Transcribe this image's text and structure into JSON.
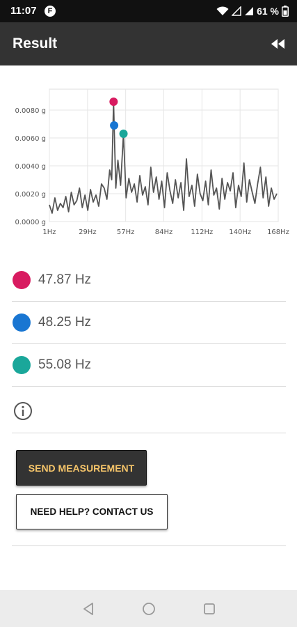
{
  "status_bar": {
    "time": "11:07",
    "app_icon_letter": "F",
    "battery_text": "61 %"
  },
  "app_bar": {
    "title": "Result"
  },
  "chart_data": {
    "type": "line",
    "x_tick_labels": [
      "1Hz",
      "29Hz",
      "57Hz",
      "84Hz",
      "112Hz",
      "140Hz",
      "168Hz"
    ],
    "y_tick_labels": [
      "0.0000 g",
      "0.0020 g",
      "0.0040 g",
      "0.0060 g",
      "0.0080 g"
    ],
    "xlim": [
      1,
      168
    ],
    "ylim": [
      0,
      0.0095
    ],
    "grid": true,
    "series_color": "#555555",
    "series": [
      {
        "x": [
          1,
          3,
          5,
          7,
          9,
          11,
          13,
          15,
          17,
          19,
          21,
          23,
          25,
          27,
          29,
          31,
          33,
          35,
          37,
          39,
          41,
          43,
          45,
          46.5,
          47.87,
          48.25,
          49.5,
          51,
          53,
          55.08,
          57,
          59,
          61,
          63,
          65,
          67,
          69,
          71,
          73,
          75,
          77,
          79,
          81,
          83,
          85,
          87,
          89,
          91,
          93,
          95,
          97,
          99,
          101,
          103,
          105,
          107,
          109,
          111,
          113,
          115,
          117,
          119,
          121,
          123,
          125,
          127,
          129,
          131,
          133,
          135,
          137,
          139,
          141,
          143,
          145,
          147,
          149,
          151,
          153,
          155,
          157,
          159,
          161,
          163,
          165,
          167
        ],
        "y": [
          0.0012,
          0.0006,
          0.0017,
          0.0008,
          0.0013,
          0.001,
          0.0018,
          0.0007,
          0.0021,
          0.0012,
          0.0015,
          0.0024,
          0.001,
          0.0019,
          0.0008,
          0.0023,
          0.0014,
          0.0019,
          0.0011,
          0.0027,
          0.0024,
          0.0016,
          0.0037,
          0.003,
          0.0086,
          0.0069,
          0.0024,
          0.0044,
          0.0026,
          0.0063,
          0.0017,
          0.0031,
          0.0021,
          0.0027,
          0.0014,
          0.0033,
          0.0019,
          0.0025,
          0.0012,
          0.0039,
          0.0021,
          0.0032,
          0.0016,
          0.0029,
          0.001,
          0.0035,
          0.0022,
          0.0013,
          0.003,
          0.0017,
          0.0028,
          0.0008,
          0.0045,
          0.0018,
          0.0026,
          0.0011,
          0.0034,
          0.002,
          0.0015,
          0.0029,
          0.0012,
          0.0037,
          0.0019,
          0.0024,
          0.0009,
          0.0031,
          0.0016,
          0.0028,
          0.0022,
          0.0035,
          0.001,
          0.0026,
          0.0018,
          0.0042,
          0.0014,
          0.003,
          0.0021,
          0.0013,
          0.0027,
          0.0039,
          0.0017,
          0.0032,
          0.0011,
          0.0024,
          0.0016,
          0.002
        ]
      }
    ],
    "peaks": [
      {
        "x": 47.87,
        "y": 0.0086,
        "color": "#d81b60"
      },
      {
        "x": 48.25,
        "y": 0.0069,
        "color": "#1976d2"
      },
      {
        "x": 55.08,
        "y": 0.0063,
        "color": "#1aa79a"
      }
    ]
  },
  "results": [
    {
      "label": "47.87 Hz",
      "color": "#d81b60"
    },
    {
      "label": "48.25 Hz",
      "color": "#1976d2"
    },
    {
      "label": "55.08 Hz",
      "color": "#1aa79a"
    }
  ],
  "buttons": {
    "send_label": "SEND MEASUREMENT",
    "help_label": "NEED HELP? CONTACT US"
  },
  "icons": {
    "rewind": "rewind-icon",
    "info": "info-icon",
    "nav_back": "back-icon",
    "nav_home": "home-icon",
    "nav_recents": "recents-icon"
  }
}
